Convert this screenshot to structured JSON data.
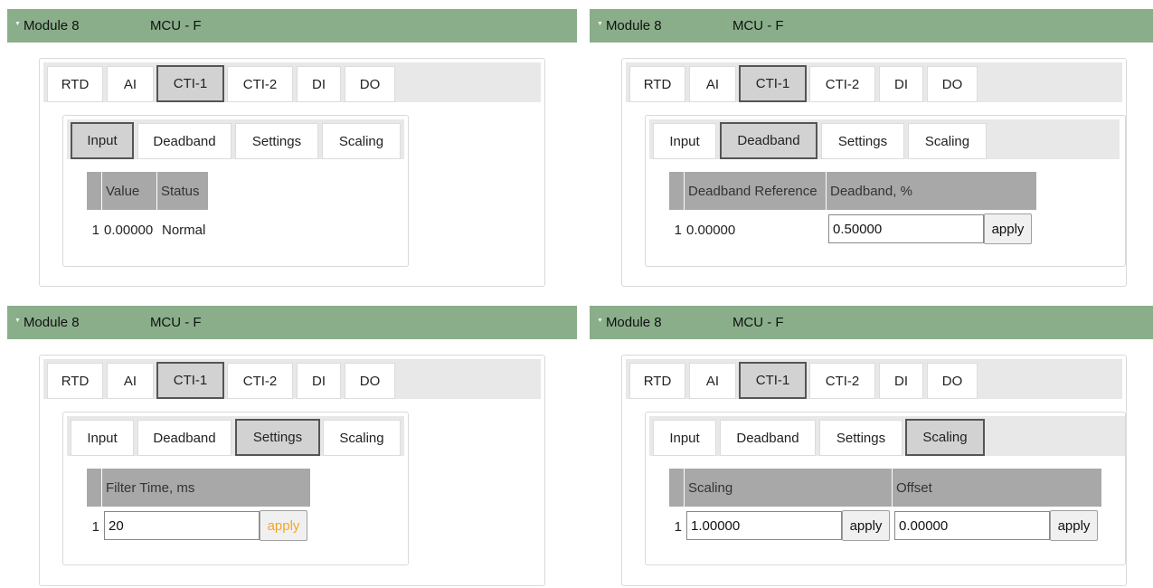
{
  "header": {
    "module": "Module 8",
    "mcu": "MCU - F"
  },
  "tabs_top": [
    "RTD",
    "AI",
    "CTI-1",
    "CTI-2",
    "DI",
    "DO"
  ],
  "tabs_sub": [
    "Input",
    "Deadband",
    "Settings",
    "Scaling"
  ],
  "input": {
    "cols": [
      "Value",
      "Status"
    ],
    "row": {
      "idx": "1",
      "value": "0.00000",
      "status": "Normal"
    }
  },
  "deadband": {
    "cols": [
      "Deadband Reference",
      "Deadband, %"
    ],
    "row": {
      "idx": "1",
      "reference": "0.00000",
      "value": "0.50000",
      "apply": "apply"
    }
  },
  "settings": {
    "cols": [
      "Filter Time, ms"
    ],
    "row": {
      "idx": "1",
      "value": "20",
      "apply": "apply"
    }
  },
  "scaling": {
    "cols": [
      "Scaling",
      "Offset"
    ],
    "row": {
      "idx": "1",
      "scaling": "1.00000",
      "scaling_apply": "apply",
      "offset": "0.00000",
      "offset_apply": "apply"
    }
  },
  "colors": {
    "header_bg": "#8aae8a",
    "active_tab_bg": "#d2d2d2",
    "table_header_bg": "#a8a8a8",
    "apply_highlight": "#f5a623"
  }
}
